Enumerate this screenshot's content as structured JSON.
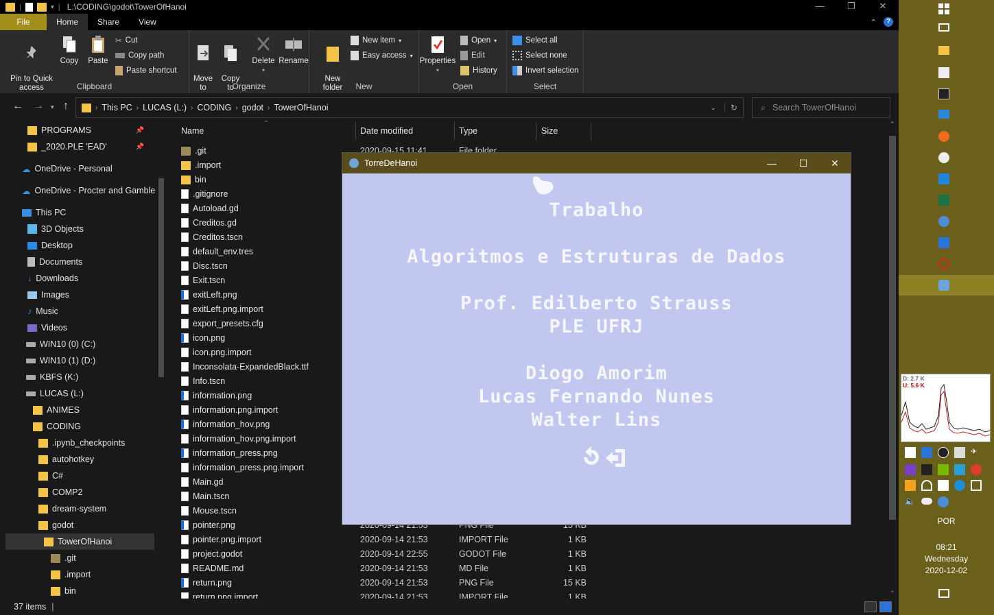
{
  "window": {
    "path": "L:\\CODING\\godot\\TowerOfHanoi",
    "controls": [
      "—",
      "❐",
      "✕"
    ]
  },
  "tabs": {
    "file": "File",
    "home": "Home",
    "share": "Share",
    "view": "View"
  },
  "ribbon": {
    "clipboard": {
      "label": "Clipboard",
      "pin": "Pin to Quick\naccess",
      "copy": "Copy",
      "paste": "Paste",
      "cut": "Cut",
      "copy_path": "Copy path",
      "paste_shortcut": "Paste shortcut"
    },
    "organize": {
      "label": "Organize",
      "move_to": "Move\nto",
      "copy_to": "Copy\nto",
      "delete": "Delete",
      "rename": "Rename"
    },
    "new": {
      "label": "New",
      "new_folder": "New\nfolder",
      "new_item": "New item",
      "easy_access": "Easy access"
    },
    "open": {
      "label": "Open",
      "properties": "Properties",
      "open": "Open",
      "edit": "Edit",
      "history": "History"
    },
    "select": {
      "label": "Select",
      "select_all": "Select all",
      "select_none": "Select none",
      "invert": "Invert selection"
    }
  },
  "address": {
    "crumbs": [
      "This PC",
      "LUCAS (L:)",
      "CODING",
      "godot",
      "TowerOfHanoi"
    ],
    "search_placeholder": "Search TowerOfHanoi"
  },
  "nav": {
    "items": [
      {
        "label": "PROGRAMS",
        "pinned": true
      },
      {
        "label": "_2020.PLE 'EAD'",
        "pinned": true
      },
      {
        "label": "OneDrive - Personal"
      },
      {
        "label": "OneDrive - Procter and Gamble"
      },
      {
        "label": "This PC"
      },
      {
        "label": "3D Objects"
      },
      {
        "label": "Desktop"
      },
      {
        "label": "Documents"
      },
      {
        "label": "Downloads"
      },
      {
        "label": "Images"
      },
      {
        "label": "Music"
      },
      {
        "label": "Videos"
      },
      {
        "label": "WIN10 (0) (C:)"
      },
      {
        "label": "WIN10 (1) (D:)"
      },
      {
        "label": "KBFS (K:)"
      },
      {
        "label": "LUCAS (L:)"
      },
      {
        "label": "ANIMES"
      },
      {
        "label": "CODING"
      },
      {
        "label": ".ipynb_checkpoints"
      },
      {
        "label": "autohotkey"
      },
      {
        "label": "C#"
      },
      {
        "label": "COMP2"
      },
      {
        "label": "dream-system"
      },
      {
        "label": "godot"
      },
      {
        "label": "TowerOfHanoi"
      },
      {
        "label": ".git"
      },
      {
        "label": ".import"
      },
      {
        "label": "bin"
      }
    ]
  },
  "columns": {
    "name": "Name",
    "date": "Date modified",
    "type": "Type",
    "size": "Size"
  },
  "files": [
    {
      "name": ".git",
      "date": "2020-09-15 11:41",
      "type": "File folder",
      "size": ""
    },
    {
      "name": ".import",
      "date": "",
      "type": "",
      "size": ""
    },
    {
      "name": "bin",
      "date": "",
      "type": "",
      "size": ""
    },
    {
      "name": ".gitignore",
      "date": "",
      "type": "",
      "size": ""
    },
    {
      "name": "Autoload.gd",
      "date": "",
      "type": "",
      "size": ""
    },
    {
      "name": "Creditos.gd",
      "date": "",
      "type": "",
      "size": ""
    },
    {
      "name": "Creditos.tscn",
      "date": "",
      "type": "",
      "size": ""
    },
    {
      "name": "default_env.tres",
      "date": "",
      "type": "",
      "size": ""
    },
    {
      "name": "Disc.tscn",
      "date": "",
      "type": "",
      "size": ""
    },
    {
      "name": "Exit.tscn",
      "date": "",
      "type": "",
      "size": ""
    },
    {
      "name": "exitLeft.png",
      "date": "",
      "type": "",
      "size": ""
    },
    {
      "name": "exitLeft.png.import",
      "date": "",
      "type": "",
      "size": ""
    },
    {
      "name": "export_presets.cfg",
      "date": "",
      "type": "",
      "size": ""
    },
    {
      "name": "icon.png",
      "date": "",
      "type": "",
      "size": ""
    },
    {
      "name": "icon.png.import",
      "date": "",
      "type": "",
      "size": ""
    },
    {
      "name": "Inconsolata-ExpandedBlack.ttf",
      "date": "",
      "type": "",
      "size": ""
    },
    {
      "name": "Info.tscn",
      "date": "",
      "type": "",
      "size": ""
    },
    {
      "name": "information.png",
      "date": "",
      "type": "",
      "size": ""
    },
    {
      "name": "information.png.import",
      "date": "",
      "type": "",
      "size": ""
    },
    {
      "name": "information_hov.png",
      "date": "",
      "type": "",
      "size": ""
    },
    {
      "name": "information_hov.png.import",
      "date": "",
      "type": "",
      "size": ""
    },
    {
      "name": "information_press.png",
      "date": "",
      "type": "",
      "size": ""
    },
    {
      "name": "information_press.png.import",
      "date": "",
      "type": "",
      "size": ""
    },
    {
      "name": "Main.gd",
      "date": "",
      "type": "",
      "size": ""
    },
    {
      "name": "Main.tscn",
      "date": "",
      "type": "",
      "size": ""
    },
    {
      "name": "Mouse.tscn",
      "date": "",
      "type": "",
      "size": ""
    },
    {
      "name": "pointer.png",
      "date": "2020-09-14 21:53",
      "type": "PNG File",
      "size": "15 KB"
    },
    {
      "name": "pointer.png.import",
      "date": "2020-09-14 21:53",
      "type": "IMPORT File",
      "size": "1 KB"
    },
    {
      "name": "project.godot",
      "date": "2020-09-14 22:55",
      "type": "GODOT File",
      "size": "1 KB"
    },
    {
      "name": "README.md",
      "date": "2020-09-14 21:53",
      "type": "MD File",
      "size": "1 KB"
    },
    {
      "name": "return.png",
      "date": "2020-09-14 21:53",
      "type": "PNG File",
      "size": "15 KB"
    },
    {
      "name": "return.png.import",
      "date": "2020-09-14 21:53",
      "type": "IMPORT File",
      "size": "1 KB"
    }
  ],
  "status": {
    "count": "37 items"
  },
  "game": {
    "title": "TorreDeHanoi",
    "lines": [
      "Trabalho",
      "Algoritmos e Estruturas de Dados",
      "Prof. Edilberto Strauss",
      "PLE UFRJ",
      "Diogo Amorim",
      "Lucas Fernando Nunes",
      "Walter Lins"
    ]
  },
  "taskbar": {
    "net_down": "D: 2.7 K",
    "net_up": "U: 5.6 K",
    "lang": "POR",
    "time": "08:21",
    "day": "Wednesday",
    "date": "2020-12-02"
  }
}
